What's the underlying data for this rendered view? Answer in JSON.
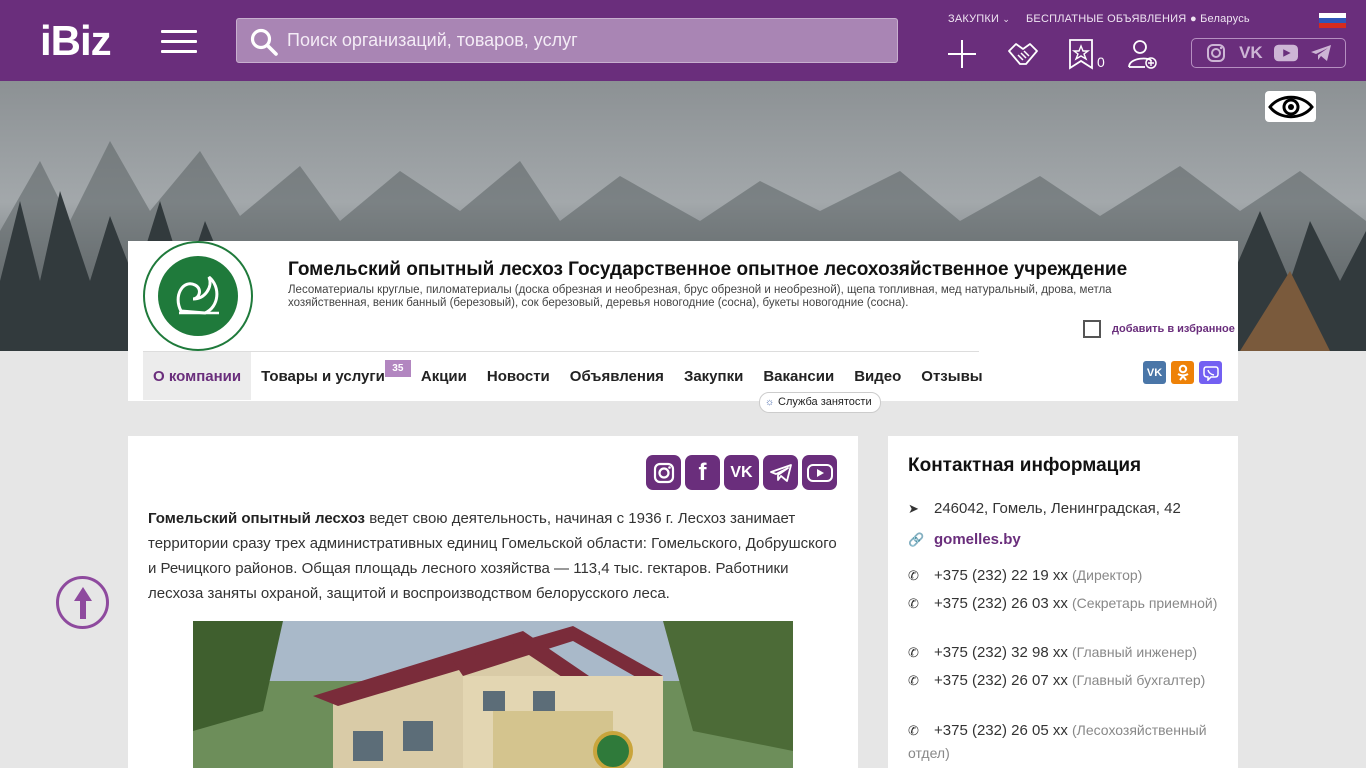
{
  "header": {
    "logo": "iBiz",
    "search_placeholder": "Поиск организаций, товаров, услуг",
    "links": {
      "purchases": "ЗАКУПКИ",
      "free_ads": "БЕСПЛАТНЫЕ ОБЪЯВЛЕНИЯ",
      "region": "Беларусь"
    },
    "favorites_count": "0",
    "flag_colors": [
      "#ffffff",
      "#2e57b8",
      "#d52b1e"
    ]
  },
  "company": {
    "title": "Гомельский опытный лесхоз Государственное опытное лесохозяйственное учреждение",
    "description": "Лесоматериалы круглые, пиломатериалы (доска обрезная и необрезная, брус обрезной и необрезной), щепа топливная, мед натуральный, дрова, метла хозяйственная, веник банный (березовый), сок березовый, деревья новогодние (сосна), букеты новогодние (сосна).",
    "add_to_favorites": "добавить в избранное",
    "nav": [
      {
        "label": "О компании"
      },
      {
        "label": "Товары и услуги",
        "badge": "35"
      },
      {
        "label": "Акции"
      },
      {
        "label": "Новости"
      },
      {
        "label": "Объявления"
      },
      {
        "label": "Закупки"
      },
      {
        "label": "Вакансии"
      },
      {
        "label": "Видео"
      },
      {
        "label": "Отзывы"
      }
    ],
    "job_service": "Служба занятости"
  },
  "about": {
    "lead": "Гомельский опытный лесхоз",
    "text": " ведет свою деятельность, начиная с 1936 г.  Лесхоз занимает территории сразу трех административных единиц Гомельской области: Гомельского, Добрушского и Речицкого районов. Общая площадь лесного хозяйства — 113,4 тыс. гектаров. Работники лесхоза заняты охраной, защитой и воспроизводством белорусского леса."
  },
  "contacts": {
    "title": "Контактная информация",
    "address": "246042, Гомель, Ленинградская, 42",
    "website": "gomelles.by",
    "phones": [
      {
        "number": "+375 (232) 22 19 xx",
        "note": "(Директор)"
      },
      {
        "number": "+375 (232) 26 03 xx",
        "note": "(Секретарь приемной)"
      },
      {
        "number": "+375 (232) 32 98 xx",
        "note": "(Главный инженер)"
      },
      {
        "number": "+375 (232) 26 07 xx",
        "note": "(Главный бухгалтер)"
      },
      {
        "number": "+375 (232) 26 05 xx",
        "note": "(Лесохозяйственный отдел)"
      }
    ]
  },
  "colors": {
    "brand": "#6a2e7c",
    "vk": "#4a76a8",
    "ok": "#ee8208",
    "viber": "#7360f2"
  }
}
